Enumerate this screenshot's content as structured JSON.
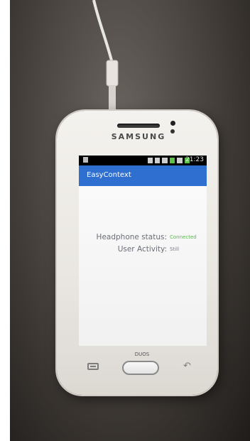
{
  "device": {
    "brand": "SAMSUNG",
    "model_badge": "DUOS"
  },
  "status_bar": {
    "time": "21:23",
    "icons": [
      "notification-icon",
      "image-icon",
      "alarm-icon",
      "wifi-icon",
      "sim-icon",
      "signal-icon",
      "battery-icon"
    ]
  },
  "app": {
    "title": "EasyContext",
    "accent_color": "#2f6fcf"
  },
  "fields": [
    {
      "label": "Headphone status:",
      "value": "Connected",
      "value_color": "#58b94e"
    },
    {
      "label": "User Activity:",
      "value": "Still",
      "value_color": "#7a7e87"
    }
  ],
  "hardware_buttons": [
    "menu",
    "home",
    "back"
  ]
}
